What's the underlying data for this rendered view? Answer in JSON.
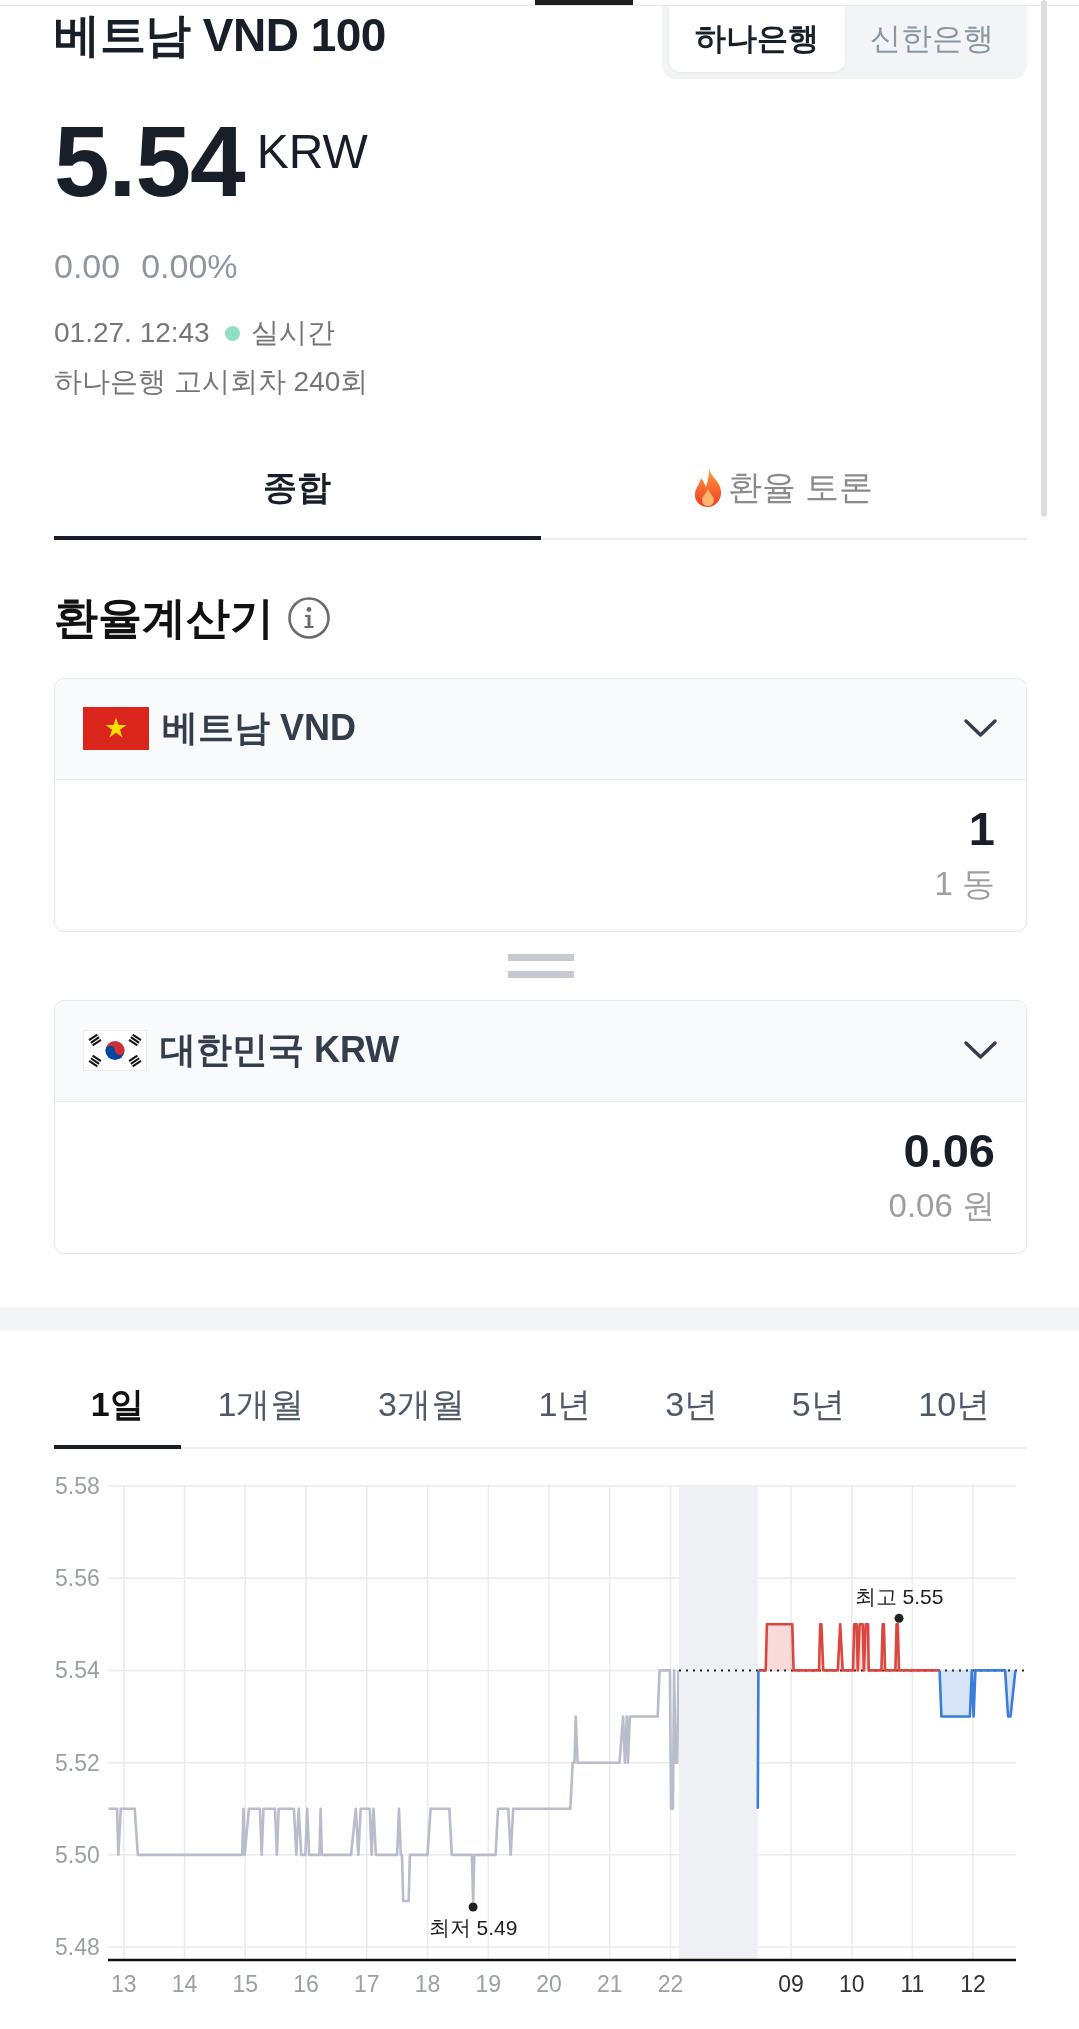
{
  "header": {
    "title": "베트남 VND 100",
    "banks": [
      {
        "label": "하나은행",
        "selected": true
      },
      {
        "label": "신한은행",
        "selected": false
      }
    ]
  },
  "quote": {
    "price": "5.54",
    "unit": "KRW",
    "change": "0.00",
    "change_rate": "0.00%",
    "time": "01.27. 12:43",
    "live": "실시간",
    "notice": "하나은행 고시회차 240회"
  },
  "tabs": [
    {
      "label": "종합",
      "kind": "plain",
      "selected": true
    },
    {
      "label": "환율 토론",
      "kind": "hot",
      "selected": false
    }
  ],
  "calculator": {
    "title": "환율계산기",
    "currencies": [
      {
        "name": "베트남 VND",
        "kind": "vn",
        "value": "1",
        "caption": "1 동"
      },
      {
        "name": "대한민국 KRW",
        "kind": "kr",
        "value": "0.06",
        "caption": "0.06 원"
      }
    ]
  },
  "periods": [
    {
      "label": "1일",
      "selected": true
    },
    {
      "label": "1개월",
      "selected": false
    },
    {
      "label": "3개월",
      "selected": false
    },
    {
      "label": "1년",
      "selected": false
    },
    {
      "label": "3년",
      "selected": false
    },
    {
      "label": "5년",
      "selected": false
    },
    {
      "label": "10년",
      "selected": false
    }
  ],
  "chart": {
    "panels": [
      {
        "chart_data": {
          "type": "line",
          "x": [
            12.75,
            12.89,
            12.91,
            12.95,
            13.18,
            13.23,
            14.95,
            14.97,
            14.99,
            15.06,
            15.24,
            15.27,
            15.3,
            15.49,
            15.52,
            15.55,
            15.8,
            15.84,
            15.88,
            15.92,
            15.99,
            16.02,
            16.05,
            16.22,
            16.24,
            16.26,
            16.74,
            16.82,
            16.86,
            16.9,
            17.05,
            17.08,
            17.11,
            17.15,
            17.5,
            17.53,
            17.56,
            17.58,
            17.6,
            17.69,
            17.71,
            18,
            18.05,
            18.36,
            18.4,
            18.73,
            18.75,
            18.77,
            19.12,
            19.16,
            19.33,
            19.37,
            19.41,
            20.35,
            20.39,
            20.42,
            20.44,
            20.47,
            21.16,
            21.22,
            21.25,
            21.28,
            21.3,
            21.33,
            21.79,
            21.82,
            21.99,
            22.01,
            22.04,
            22.06,
            22.08,
            22.11,
            22.13
          ],
          "series": [
            {
              "color": "#b9bccb",
              "values": [
                5.51,
                5.51,
                5.5,
                5.51,
                5.51,
                5.5,
                5.5,
                5.51,
                5.5,
                5.51,
                5.51,
                5.5,
                5.51,
                5.51,
                5.5,
                5.51,
                5.51,
                5.5,
                5.51,
                5.5,
                5.5,
                5.51,
                5.5,
                5.5,
                5.51,
                5.5,
                5.5,
                5.51,
                5.5,
                5.51,
                5.51,
                5.5,
                5.51,
                5.5,
                5.5,
                5.51,
                5.5,
                5.5,
                5.49,
                5.49,
                5.5,
                5.5,
                5.51,
                5.51,
                5.5,
                5.5,
                5.49,
                5.5,
                5.5,
                5.51,
                5.51,
                5.5,
                5.51,
                5.51,
                5.52,
                5.52,
                5.53,
                5.52,
                5.52,
                5.53,
                5.52,
                5.53,
                5.52,
                5.53,
                5.53,
                5.54,
                5.54,
                5.51,
                5.51,
                5.54,
                5.52,
                5.52,
                5.54
              ]
            }
          ],
          "xlim": [
            12.74,
            22.14
          ],
          "ylim": [
            5.4772,
            5.58
          ],
          "grid": true,
          "xticks": [
            {
              "value": 13,
              "label": "13"
            },
            {
              "value": 14,
              "label": "14"
            },
            {
              "value": 15,
              "label": "15"
            },
            {
              "value": 16,
              "label": "16"
            },
            {
              "value": 17,
              "label": "17"
            },
            {
              "value": 18,
              "label": "18"
            },
            {
              "value": 19,
              "label": "19"
            },
            {
              "value": 20,
              "label": "20"
            },
            {
              "value": 21,
              "label": "21"
            },
            {
              "value": 22,
              "label": "22"
            }
          ],
          "yticks": [
            {
              "value": 5.48,
              "label": "5.48"
            },
            {
              "value": 5.5,
              "label": "5.50"
            },
            {
              "value": 5.52,
              "label": "5.52"
            },
            {
              "value": 5.54,
              "label": "5.54"
            },
            {
              "value": 5.56,
              "label": "5.56"
            },
            {
              "value": 5.58,
              "label": "5.58"
            }
          ],
          "annotations": [
            {
              "x": 18.75,
              "y": 5.49,
              "text": "최저 5.49"
            }
          ]
        }
      },
      {
        "chart_data": {
          "type": "line",
          "x": [
            8.45,
            8.46,
            8.58,
            8.6,
            9.02,
            9.04,
            9.46,
            9.48,
            9.5,
            9.53,
            9.77,
            9.81,
            9.85,
            10.02,
            10.04,
            10.08,
            10.1,
            10.13,
            10.18,
            10.2,
            10.23,
            10.27,
            10.28,
            10.49,
            10.51,
            10.53,
            10.55,
            10.72,
            10.74,
            10.76,
            10.78,
            11.45,
            11.48,
            11.95,
            11.98,
            12.01,
            12.04,
            12.53,
            12.58,
            12.62,
            12.7
          ],
          "series": [
            {
              "color": "#d9473f",
              "values": [
                null,
                5.54,
                5.54,
                5.55,
                5.55,
                5.54,
                5.54,
                5.55,
                5.55,
                5.54,
                5.54,
                5.55,
                5.54,
                5.54,
                5.55,
                5.55,
                5.54,
                5.55,
                5.55,
                5.54,
                5.55,
                5.55,
                5.54,
                5.54,
                5.55,
                5.55,
                5.54,
                5.54,
                5.55,
                5.55,
                5.54,
                5.54,
                null,
                null,
                null,
                null,
                null,
                null,
                null,
                null,
                null
              ]
            },
            {
              "color": "#3b7ddd",
              "values": [
                5.51,
                5.54,
                null,
                null,
                null,
                null,
                null,
                null,
                null,
                null,
                null,
                null,
                null,
                null,
                null,
                null,
                null,
                null,
                null,
                null,
                null,
                null,
                null,
                null,
                null,
                null,
                null,
                null,
                null,
                null,
                null,
                5.54,
                5.53,
                5.53,
                5.54,
                5.53,
                5.54,
                5.54,
                5.53,
                5.53,
                5.54
              ]
            }
          ],
          "xlim": [
            7.15,
            12.71
          ],
          "ylim": [
            5.4772,
            5.58
          ],
          "grid": true,
          "xticks": [
            {
              "value": 9,
              "label": "09"
            },
            {
              "value": 10,
              "label": "10"
            },
            {
              "value": 11,
              "label": "11"
            },
            {
              "value": 12,
              "label": "12"
            }
          ],
          "bands": [
            {
              "axis": "x",
              "from": 7.15,
              "to": 8.45
            }
          ],
          "ref_lines": [
            {
              "axis": "y",
              "value": 5.54
            }
          ],
          "annotations": [
            {
              "x": 10.78,
              "y": 5.55,
              "text": "최고 5.55"
            }
          ]
        }
      }
    ]
  }
}
